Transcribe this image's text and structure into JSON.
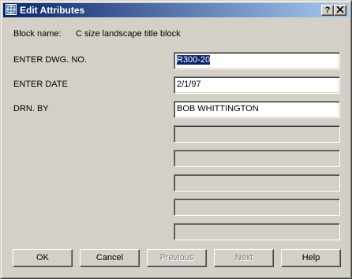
{
  "window": {
    "title": "Edit Attributes",
    "help_button": "?",
    "close_button": "X"
  },
  "block": {
    "label": "Block name:",
    "value": "C size landscape title block"
  },
  "fields": [
    {
      "label": "ENTER DWG. NO.",
      "value": "R300-20",
      "selected": true
    },
    {
      "label": "ENTER DATE",
      "value": "2/1/97"
    },
    {
      "label": "DRN. BY",
      "value": "BOB WHITTINGTON"
    },
    {
      "label": "",
      "value": ""
    },
    {
      "label": "",
      "value": ""
    },
    {
      "label": "",
      "value": ""
    },
    {
      "label": "",
      "value": ""
    },
    {
      "label": "",
      "value": ""
    }
  ],
  "buttons": {
    "ok": "OK",
    "cancel": "Cancel",
    "previous": "Previous",
    "next": "Next",
    "help": "Help"
  },
  "colors": {
    "title_bar_start": "#0a246a",
    "title_bar_end": "#a6caf0",
    "face": "#d4d0c8",
    "selection": "#0a246a"
  }
}
